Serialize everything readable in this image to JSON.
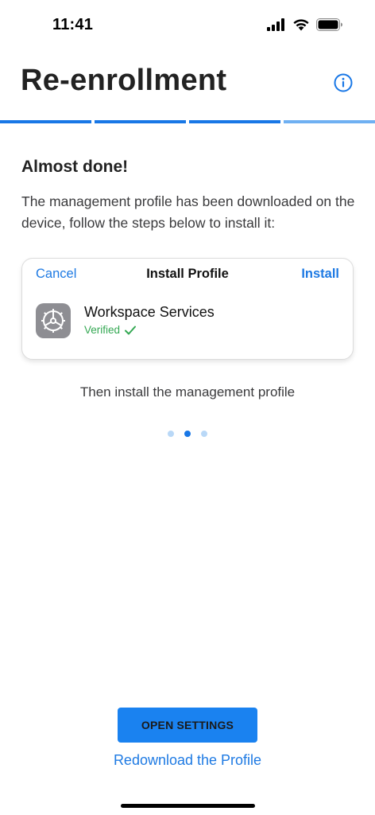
{
  "status_bar": {
    "time": "11:41"
  },
  "header": {
    "title": "Re-enrollment"
  },
  "progress": {
    "segments": 4,
    "completed_fraction": 0.75
  },
  "content": {
    "heading": "Almost done!",
    "description": "The management profile has been downloaded on the device, follow the steps below to install it:",
    "card": {
      "cancel_label": "Cancel",
      "title": "Install Profile",
      "install_label": "Install",
      "profile_name": "Workspace Services",
      "verified_label": "Verified"
    },
    "step_caption": "Then install the management profile",
    "pager": {
      "count": 3,
      "active_index": 1
    }
  },
  "actions": {
    "primary_label": "OPEN SETTINGS",
    "secondary_label": "Redownload the Profile"
  },
  "colors": {
    "accent": "#1877e6",
    "accent_light": "#b9d8f7",
    "verified": "#34a853",
    "button": "#1a82f0"
  }
}
